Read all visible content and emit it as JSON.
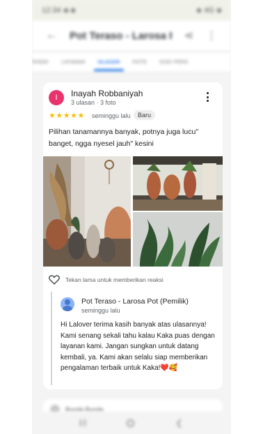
{
  "status_bar": {
    "left_text": "12:34",
    "right_text": "4G"
  },
  "app_bar": {
    "title": "Pot Teraso - Larosa Pot",
    "back_icon": "arrow-left-icon",
    "share_icon": "share-icon",
    "menu_icon": "more-vert-icon"
  },
  "tabs": [
    {
      "label": "RINGK"
    },
    {
      "label": "LAYANAN"
    },
    {
      "label": "ULASAN",
      "active": true
    },
    {
      "label": "FOTO"
    },
    {
      "label": "SUDI PERS"
    }
  ],
  "review": {
    "avatar_letter": "I",
    "avatar_color": "#e8336d",
    "name": "Inayah Robbaniyah",
    "meta": "3 ulasan · 3 foto",
    "stars": "★★★★★",
    "time": "seminggu lalu",
    "badge": "Baru",
    "text": "Pilihan tanamannya banyak, potnya juga lucu\" banget, ngga nyesel jauh\" kesini",
    "reaction_label": "Tekan lama untuk memberikan reaksi"
  },
  "owner_reply": {
    "name": "Pot Teraso - Larosa Pot (Pemilik)",
    "time": "seminggu lalu",
    "text": "Hi Lalover terima kasih banyak atas ulasannya! Kami senang sekali tahu kalau Kaka puas dengan layanan kami. Jangan sungkan untuk datang kembali, ya. Kami akan selalu siap memberikan pengalaman terbaik untuk Kaka!❤️🥰"
  },
  "next_review": {
    "name": "Bunda Bunda"
  },
  "colors": {
    "accent": "#1a73e8",
    "star": "#fbbc04",
    "avatar": "#e8336d"
  }
}
